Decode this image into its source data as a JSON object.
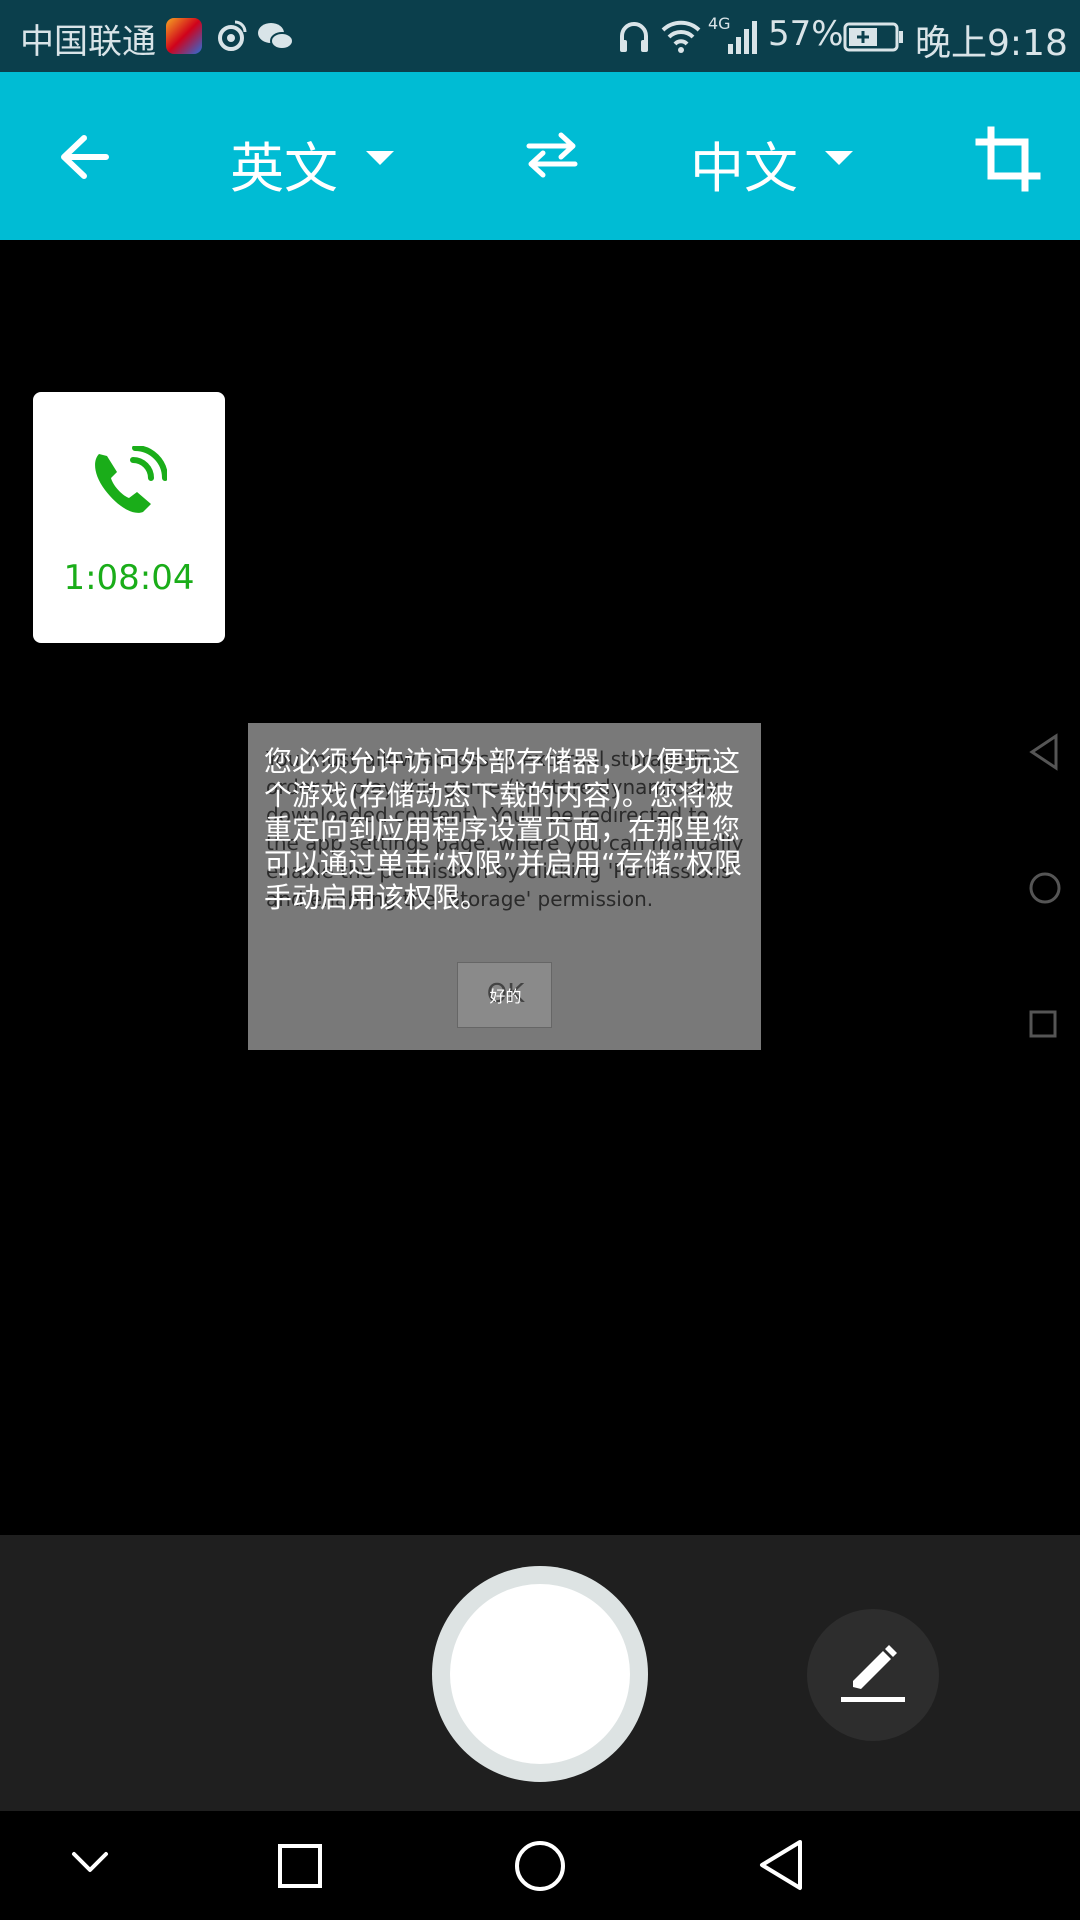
{
  "status_bar": {
    "carrier": "中国联通",
    "battery": "57%",
    "network": "4G",
    "time": "晚上9:18"
  },
  "toolbar": {
    "source_language": "英文",
    "target_language": "中文"
  },
  "call": {
    "duration": "1:08:04",
    "color": "#1aad19"
  },
  "dialog": {
    "message_en": "You must allow access to external storage in order to play this game (to store dynamically downloaded content). You'll be redirected to the app settings page, where you can manually enable the permission by clicking 'Permissions' and enabling the 'Storage' permission.",
    "message_zh": "您必须允许访问外部存储器，以便玩这个游戏(存储动态下载的内容)。您将被重定向到应用程序设置页面，在那里您可以通过单击“权限”并启用“存储”权限手动启用该权限。",
    "button_en": "OK",
    "button_zh": "好的"
  },
  "colors": {
    "toolbar": "#00bcd4",
    "status_bar": "#0b3f4c"
  }
}
